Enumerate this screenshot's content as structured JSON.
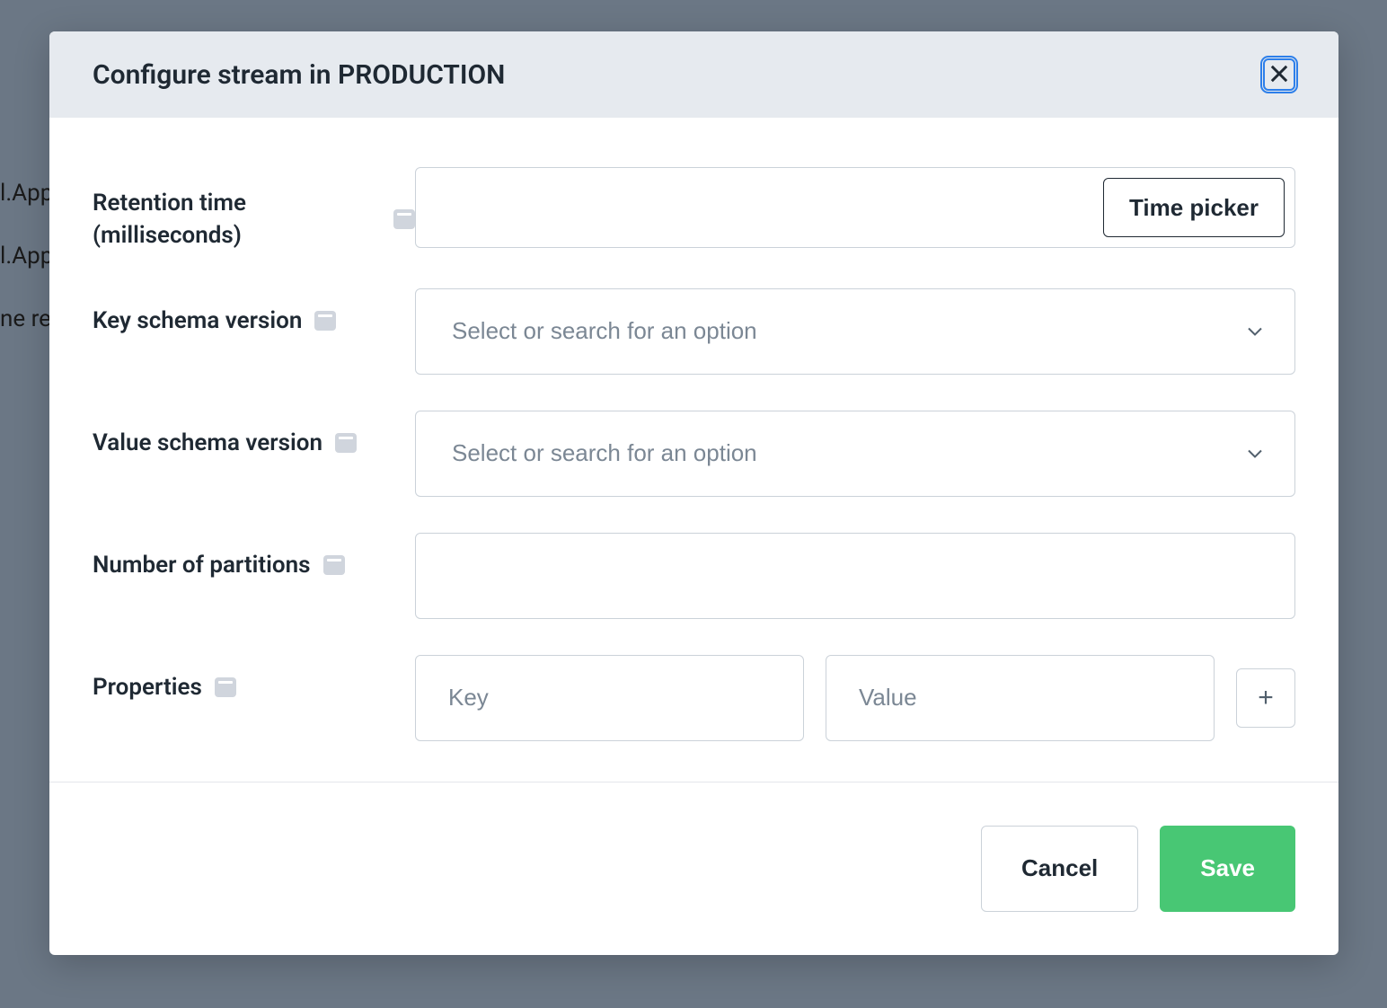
{
  "background": {
    "line1": "l.App",
    "line2": "l.App",
    "line3": "ne re"
  },
  "modal": {
    "title": "Configure stream in PRODUCTION",
    "fields": {
      "retention": {
        "label": "Retention time (milliseconds)",
        "value": "",
        "button_label": "Time picker"
      },
      "key_schema": {
        "label": "Key schema version",
        "placeholder": "Select or search for an option"
      },
      "value_schema": {
        "label": "Value schema version",
        "placeholder": "Select or search for an option"
      },
      "partitions": {
        "label": "Number of partitions",
        "value": ""
      },
      "properties": {
        "label": "Properties",
        "key_placeholder": "Key",
        "value_placeholder": "Value"
      }
    },
    "footer": {
      "cancel": "Cancel",
      "save": "Save"
    }
  }
}
